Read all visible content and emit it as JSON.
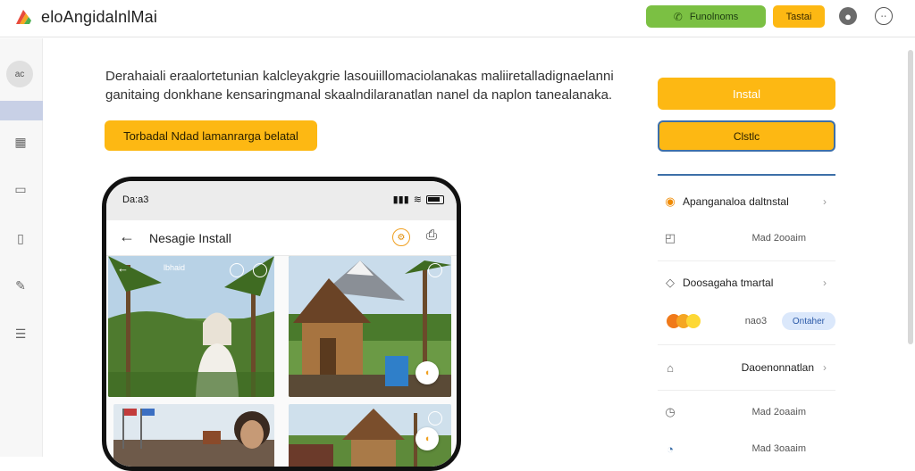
{
  "header": {
    "brand": "eloAngidalnlMai",
    "green_button": "Funolnoms",
    "orange_button": "Tastai",
    "icons": [
      "user-icon",
      "face-icon"
    ]
  },
  "sidebar": {
    "avatar_text": "ac",
    "items": [
      "grid-icon",
      "folder-icon",
      "card-icon",
      "edit-icon",
      "list-icon"
    ]
  },
  "main": {
    "description": "Derahaiali eraalortetunian kalcleyakgrie lasouiillomaciolanakas maliiretalladignaelanni ganitaing donkhane kensaringmanal skaalndilaranatlan nanel da naplon tanealanaka.",
    "cta": "Torbadal Ndad lamanrarga belatal"
  },
  "phone": {
    "time": "Da:a3",
    "title": "Nesagie Install",
    "tile_label": "lbhaid",
    "tiles": [
      "woman-in-forest",
      "village-hut",
      "crowd-gathering",
      "market-village"
    ]
  },
  "right_panel": {
    "install_button": "Instal",
    "secondary_button": "Clstlc",
    "rows": [
      {
        "label": "Apanganaloa daltnstal",
        "icon": "circle-orange-icon"
      },
      {
        "sub": "Mad 2ooaim",
        "icon": "square-icon"
      },
      {
        "label": "Doosagaha tmartal",
        "icon": "diamond-icon"
      },
      {
        "sub": "nao3",
        "pill": "Ontaher",
        "icon": "toggle-dots"
      },
      {
        "label": "Daoenonnatlan",
        "icon": "building-icon"
      },
      {
        "sub": "Mad 2oaaim",
        "icon": "clock-icon"
      },
      {
        "sub": "Mad 3oaaim",
        "icon": "clock2-icon"
      }
    ]
  },
  "colors": {
    "accent_orange": "#fdb813",
    "accent_green": "#7bc043",
    "accent_blue": "#3d6fa8"
  }
}
